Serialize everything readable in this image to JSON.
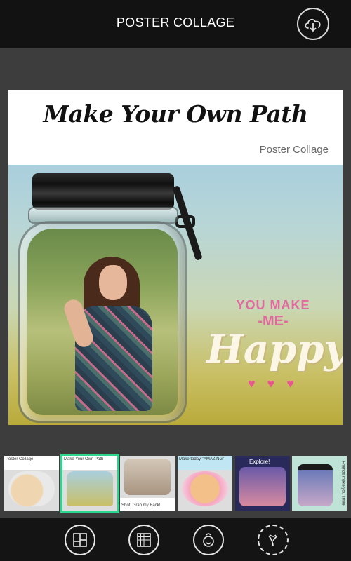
{
  "header": {
    "title": "POSTER COLLAGE",
    "download_icon": "cloud-download-icon"
  },
  "poster": {
    "heading": "Make Your Own Path",
    "subheading": "Poster Collage",
    "sticker": {
      "line1": "YOU MAKE",
      "line2": "-ME-",
      "line3": "Happy",
      "hearts": "♥ ♥ ♥"
    }
  },
  "thumbnails": [
    {
      "label": "Poster Collage",
      "selected": false
    },
    {
      "label": "Make Your Own Path",
      "selected": true
    },
    {
      "label": "Shot! Grab my Back!",
      "selected": false
    },
    {
      "label": "Make today \"AMAZING\"",
      "selected": false
    },
    {
      "label": "Explore!",
      "selected": false
    },
    {
      "label": "Friends make you smile",
      "selected": false
    }
  ],
  "toolbar": {
    "tools": [
      {
        "icon": "layout-grid-icon"
      },
      {
        "icon": "pattern-grid-icon"
      },
      {
        "icon": "sticker-face-icon"
      },
      {
        "icon": "frame-style-icon"
      }
    ]
  },
  "colors": {
    "header_bg": "#121212",
    "background": "#3d3d3d",
    "selected_accent": "#2fd58c",
    "sticker_pink": "#e06aa0"
  }
}
